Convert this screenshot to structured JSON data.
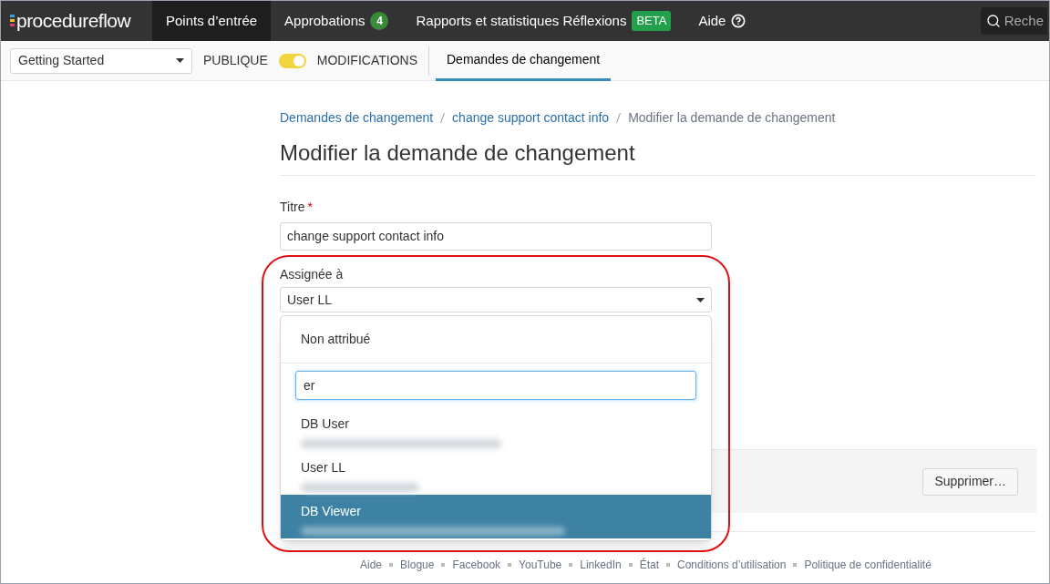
{
  "topnav": {
    "logo": "procedureflow",
    "items": [
      {
        "label": "Points d’entrée",
        "selected": true
      },
      {
        "label": "Approbations",
        "selected": false,
        "count": "4"
      },
      {
        "label": "Rapports et statistiques Réflexions",
        "selected": false,
        "badge": "BETA"
      },
      {
        "label": "Aide",
        "selected": false,
        "help": true
      }
    ],
    "search": {
      "placeholder": "Reche"
    }
  },
  "subbar": {
    "project": "Getting Started",
    "toggle_left": "PUBLIQUE",
    "toggle_on": true,
    "toggle_right": "MODIFICATIONS",
    "tabs": [
      {
        "label": "Demandes de changement",
        "selected": true
      }
    ]
  },
  "breadcrumb": [
    "Demandes de changement",
    "change support contact info",
    "Modifier la demande de changement"
  ],
  "heading": "Modifier la demande de changement",
  "form": {
    "title_label": "Titre",
    "required_mark": "*",
    "title_value": "change support contact info",
    "assignee_label": "Assignée à",
    "assignee_value": "User LL"
  },
  "dropdown": {
    "unassigned": "Non attribué",
    "search_value": "er",
    "options": [
      {
        "name": "DB User",
        "selected": false
      },
      {
        "name": "User LL",
        "selected": false
      },
      {
        "name": "DB Viewer",
        "selected": true
      }
    ]
  },
  "delete_button": "Supprimer…",
  "footer": [
    "Aide",
    "Blogue",
    "Facebook",
    "YouTube",
    "LinkedIn",
    "État",
    "Conditions d’utilisation",
    "Politique de confidentialité"
  ]
}
